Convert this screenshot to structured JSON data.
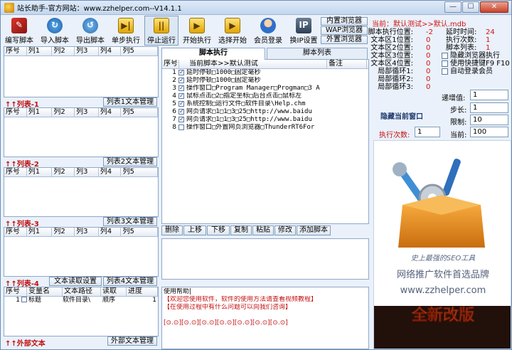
{
  "window": {
    "title": "站长助手-官方网站：www.zzhelper.com--V14.1.1",
    "controls": {
      "minimize": "—",
      "maximize": "☐",
      "close": "✕"
    }
  },
  "toolbar": [
    {
      "label": "编写脚本",
      "icon": "edit-script-icon",
      "glyph": "✎"
    },
    {
      "label": "导入脚本",
      "icon": "import-icon",
      "glyph": "↻"
    },
    {
      "label": "导出脚本",
      "icon": "export-icon",
      "glyph": "↺"
    },
    {
      "label": "单步执行",
      "icon": "step-icon",
      "glyph": "▶|"
    },
    {
      "label": "停止运行",
      "icon": "pause-icon",
      "glyph": "||"
    },
    {
      "label": "开始执行",
      "icon": "play-icon",
      "glyph": "▶"
    },
    {
      "label": "选择开始",
      "icon": "select-start-icon",
      "glyph": "▶"
    },
    {
      "label": "会员登录",
      "icon": "user-icon",
      "glyph": ""
    },
    {
      "label": "换IP设置",
      "icon": "ip-icon",
      "glyph": "IP"
    }
  ],
  "browsers": [
    "内置浏览器",
    "WAP浏览器",
    "外置浏览器"
  ],
  "current": "当前：默认测试>>默认.mdb",
  "stats": {
    "rows": [
      {
        "l1": "脚本执行位置:",
        "v1": "-2",
        "l2": "延时时间:",
        "v2": "24"
      },
      {
        "l1": "文本区1位置:",
        "v1": "0",
        "l2": "执行次数:",
        "v2": "1"
      },
      {
        "l1": "文本区2位置:",
        "v1": "0",
        "l2": "脚本列表:",
        "v2": "1"
      },
      {
        "l1": "文本区3位置:",
        "v1": "0"
      },
      {
        "l1": "文本区4位置:",
        "v1": "0"
      },
      {
        "l1": "局部循环1:",
        "v1": "0"
      },
      {
        "l1": "局部循环2:",
        "v1": "0"
      },
      {
        "l1": "局部循环3:",
        "v1": "0"
      }
    ],
    "checks": [
      "隐藏浏览器执行",
      "使用快捷键F9 F10",
      "自动登录会员"
    ],
    "hide_window": "隐藏当前窗口"
  },
  "lists": {
    "header": [
      "序号",
      "列1",
      "列2",
      "列3",
      "列4",
      "列5"
    ],
    "captions": [
      {
        "title": "↑↑列表-1",
        "button": "列表1文本管理"
      },
      {
        "title": "↑↑列表-2",
        "button": "列表2文本管理"
      },
      {
        "title": "↑↑列表-3",
        "button": "列表3文本管理"
      },
      {
        "title": "↑↑列表-4",
        "button": "列表4文本管理",
        "extra": "文本读取设置"
      }
    ]
  },
  "external": {
    "header": [
      "序号",
      "变量名",
      "文本路径",
      "读取",
      "进度"
    ],
    "row": {
      "num": "1",
      "name": "标题",
      "path": "软件目录\\",
      "mode": "顺序",
      "progress": "1"
    },
    "caption": "↑↑外部文本",
    "button": "外部文本管理"
  },
  "script": {
    "tabs": [
      "脚本执行",
      "脚本列表"
    ],
    "header": {
      "num": "序号",
      "name": "当前脚本>>默认测试",
      "note": "备注"
    },
    "rows": [
      {
        "num": "1",
        "text": "延时停顿□1000□固定毫秒"
      },
      {
        "num": "2",
        "text": "延时停顿□1000□固定毫秒"
      },
      {
        "num": "3",
        "text": "操作窗口□Program Manager□Progman□3 A"
      },
      {
        "num": "4",
        "text": "鼠标点击□2□指定坐标□后台点击□鼠标左"
      },
      {
        "num": "5",
        "text": "系统控制□运行文件□软件目录\\Help.chm"
      },
      {
        "num": "6",
        "text": "网页请求□1□1□3□25□http://www.baidu"
      },
      {
        "num": "7",
        "text": "网页请求□1□1□3□25□http://www.baidu"
      },
      {
        "num": "8",
        "text": "操作窗口□外置网页浏览器□ThunderRT6For"
      }
    ],
    "actions": [
      "删除",
      "上移",
      "下移",
      "复制",
      "粘贴",
      "修改",
      "添加脚本"
    ]
  },
  "help": {
    "title": "使用帮助|",
    "lines": [
      "【欢迎您使用软件，软件的使用方法请查看视频教程】",
      "【在使用过程中有什么问题可以向我们咨询】",
      "",
      "[⊙.⊙][⊙.⊙][⊙.⊙][⊙.⊙][⊙.⊙][⊙.⊙][⊙.⊙]"
    ]
  },
  "settings": {
    "exec_count_label": "执行次数:",
    "exec_count": "1",
    "increment_label": "递增值:",
    "increment": "1",
    "step_label": "步长:",
    "step": "1",
    "limit_label": "限制:",
    "limit": "10",
    "current_label": "当前:",
    "current": "100"
  },
  "ad": {
    "slogan": "史上最强的SEO工具",
    "brand": "网络推广软件首选品牌",
    "site": "www.zzhelper.com",
    "badge": "全新改版"
  },
  "colors": {
    "accent_red": "#c21010",
    "border": "#7f9db9"
  }
}
